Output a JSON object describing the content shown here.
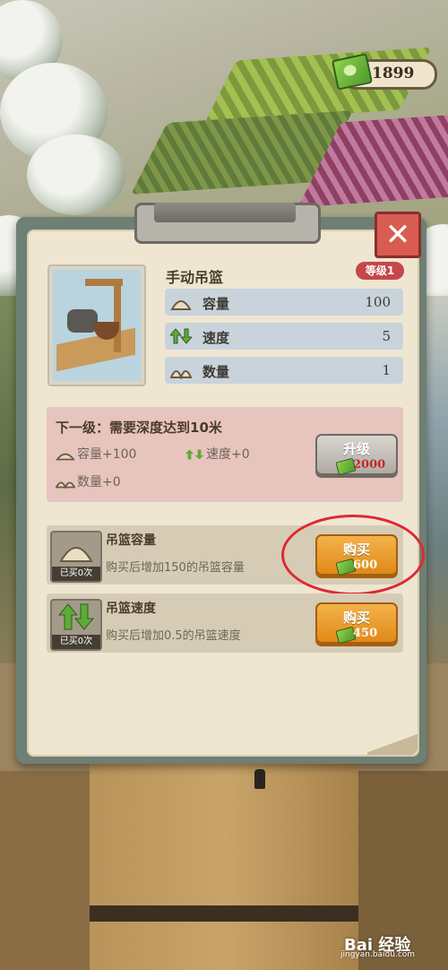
{
  "hud": {
    "currency": "1899"
  },
  "panel": {
    "close_label": "✕",
    "item": {
      "title": "手动吊篮",
      "level": "等级1",
      "stats": [
        {
          "icon": "capacity-icon",
          "label": "容量",
          "value": "100"
        },
        {
          "icon": "speed-icon",
          "label": "速度",
          "value": "5"
        },
        {
          "icon": "quantity-icon",
          "label": "数量",
          "value": "1"
        }
      ]
    },
    "next_level": {
      "title": "下一级：需要深度达到10米",
      "capacity": "容量+100",
      "speed": "速度+0",
      "quantity": "数量+0",
      "upgrade_label": "升级",
      "upgrade_price": "2000"
    },
    "shop": [
      {
        "name": "吊篮容量",
        "desc": "购买后增加150的吊篮容量",
        "bought": "已买0次",
        "button": "购买",
        "price": "600"
      },
      {
        "name": "吊篮速度",
        "desc": "购买后增加0.5的吊篮速度",
        "bought": "已买0次",
        "button": "购买",
        "price": "450"
      }
    ]
  },
  "watermark": {
    "text": "Bai 经验",
    "url": "jingyan.baidu.com"
  },
  "colors": {
    "accent_orange": "#e08a18",
    "badge_red": "#c4474a",
    "highlight_red": "#e02832",
    "price_red": "#c0282c"
  }
}
